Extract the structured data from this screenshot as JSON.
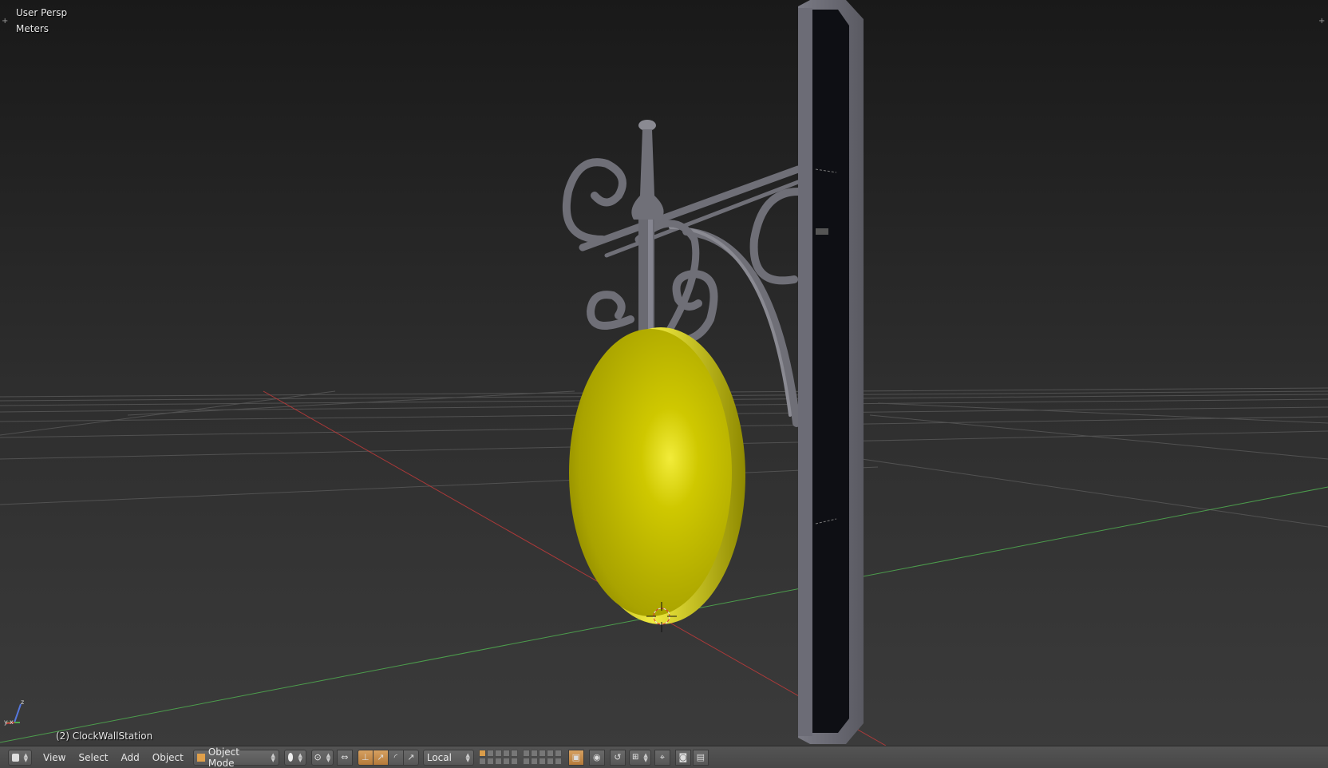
{
  "viewport": {
    "view_name": "User Persp",
    "units": "Meters",
    "object_info": "(2) ClockWallStation",
    "axis_x_label": "x",
    "axis_y_label": "y",
    "axis_z_label": "z",
    "colors": {
      "x_axis": "#c03a3a",
      "y_axis": "#4fa84f",
      "clock_face": "#c8c200",
      "metal": "#6d6d74",
      "post_face": "#0e0f14"
    }
  },
  "header": {
    "menus": {
      "view": "View",
      "select": "Select",
      "add": "Add",
      "object": "Object"
    },
    "mode": "Object Mode",
    "pivot_orientation": "Local"
  }
}
